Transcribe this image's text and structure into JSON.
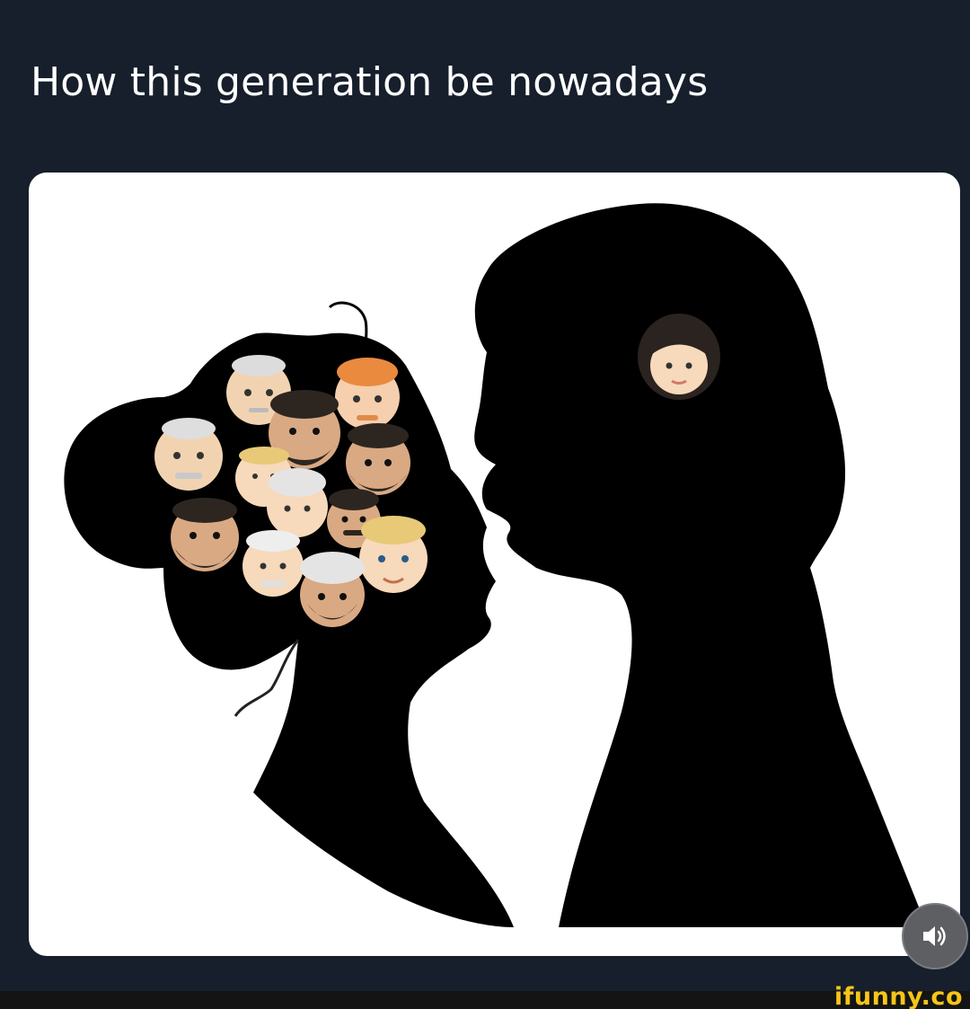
{
  "post": {
    "text": "How this generation be nowadays"
  },
  "media": {
    "description_icon_names": [
      "woman-silhouette",
      "man-silhouette",
      "woman-emoji",
      "man-emoji"
    ],
    "woman_head_emojis": [
      "old-man",
      "red-hair-man",
      "old-man",
      "bearded-man",
      "blond-man",
      "turban-man",
      "bearded-man",
      "bearded-man",
      "old-man-white",
      "turban-man",
      "blond-man",
      "mustache-man"
    ],
    "man_head_emoji": "woman-dark-hair"
  },
  "controls": {
    "sound_icon": "speaker-on-icon"
  },
  "footer": {
    "watermark": "ifunny.co"
  },
  "colors": {
    "background": "#161f2b",
    "card": "#ffffff",
    "silhouette": "#000000",
    "watermark": "#f5c518"
  }
}
